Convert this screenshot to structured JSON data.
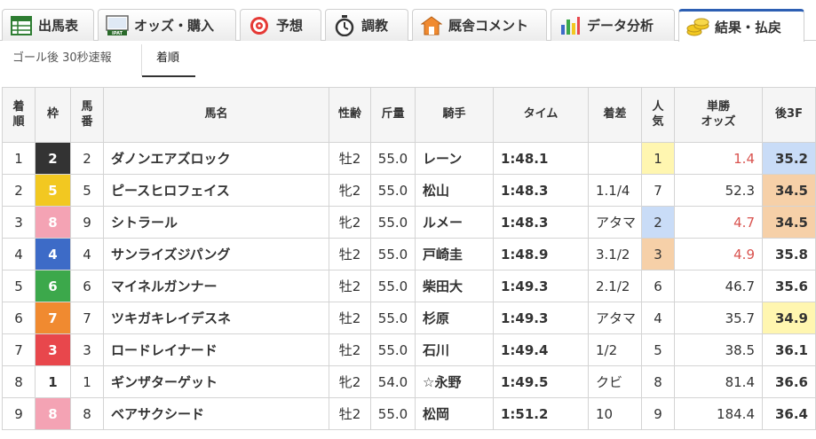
{
  "tabs": [
    {
      "label": "出馬表",
      "icon": "table-icon",
      "active": false
    },
    {
      "label": "オッズ・購入",
      "icon": "ipat-icon",
      "active": false
    },
    {
      "label": "予想",
      "icon": "target-icon",
      "active": false
    },
    {
      "label": "調教",
      "icon": "stopwatch-icon",
      "active": false
    },
    {
      "label": "厩舎コメント",
      "icon": "stable-icon",
      "active": false
    },
    {
      "label": "データ分析",
      "icon": "bar-chart-icon",
      "active": false
    },
    {
      "label": "結果・払戻",
      "icon": "coins-icon",
      "active": true
    }
  ],
  "ipat_badge": "IPAT",
  "subtabs": [
    {
      "label": "ゴール後 30秒速報",
      "active": false
    },
    {
      "label": "着順",
      "active": true
    }
  ],
  "table": {
    "headers": {
      "rank": "着\n順",
      "waku": "枠",
      "umaban": "馬\n番",
      "name": "馬名",
      "sexage": "性齢",
      "weight": "斤量",
      "jockey": "騎手",
      "time": "タイム",
      "margin": "着差",
      "pop": "人\n気",
      "odds": "単勝\nオッズ",
      "last3f": "後3F"
    },
    "rows": [
      {
        "rank": "1",
        "waku": "2",
        "umaban": "2",
        "name": "ダノンエアズロック",
        "sexage": "牡2",
        "weight": "55.0",
        "jockey": "レーン",
        "time": "1:48.1",
        "margin": "",
        "pop": "1",
        "odds": "1.4",
        "last3f": "35.2"
      },
      {
        "rank": "2",
        "waku": "5",
        "umaban": "5",
        "name": "ピースヒロフェイス",
        "sexage": "牝2",
        "weight": "55.0",
        "jockey": "松山",
        "time": "1:48.3",
        "margin": "1.1/4",
        "pop": "7",
        "odds": "52.3",
        "last3f": "34.5"
      },
      {
        "rank": "3",
        "waku": "8",
        "umaban": "9",
        "name": "シトラール",
        "sexage": "牝2",
        "weight": "55.0",
        "jockey": "ルメー",
        "time": "1:48.3",
        "margin": "アタマ",
        "pop": "2",
        "odds": "4.7",
        "last3f": "34.5"
      },
      {
        "rank": "4",
        "waku": "4",
        "umaban": "4",
        "name": "サンライズジパング",
        "sexage": "牡2",
        "weight": "55.0",
        "jockey": "戸崎圭",
        "time": "1:48.9",
        "margin": "3.1/2",
        "pop": "3",
        "odds": "4.9",
        "last3f": "35.8"
      },
      {
        "rank": "5",
        "waku": "6",
        "umaban": "6",
        "name": "マイネルガンナー",
        "sexage": "牡2",
        "weight": "55.0",
        "jockey": "柴田大",
        "time": "1:49.3",
        "margin": "2.1/2",
        "pop": "6",
        "odds": "46.7",
        "last3f": "35.6"
      },
      {
        "rank": "6",
        "waku": "7",
        "umaban": "7",
        "name": "ツキガキレイデスネ",
        "sexage": "牡2",
        "weight": "55.0",
        "jockey": "杉原",
        "time": "1:49.3",
        "margin": "アタマ",
        "pop": "4",
        "odds": "35.7",
        "last3f": "34.9"
      },
      {
        "rank": "7",
        "waku": "3",
        "umaban": "3",
        "name": "ロードレイナード",
        "sexage": "牡2",
        "weight": "55.0",
        "jockey": "石川",
        "time": "1:49.4",
        "margin": "1/2",
        "pop": "5",
        "odds": "38.5",
        "last3f": "36.1"
      },
      {
        "rank": "8",
        "waku": "1",
        "umaban": "1",
        "name": "ギンザターゲット",
        "sexage": "牝2",
        "weight": "54.0",
        "jockey": "☆永野",
        "time": "1:49.5",
        "margin": "クビ",
        "pop": "8",
        "odds": "81.4",
        "last3f": "36.6"
      },
      {
        "rank": "9",
        "waku": "8",
        "umaban": "8",
        "name": "ベアサクシード",
        "sexage": "牡2",
        "weight": "55.0",
        "jockey": "松岡",
        "time": "1:51.2",
        "margin": "10",
        "pop": "9",
        "odds": "184.4",
        "last3f": "36.4"
      }
    ]
  },
  "colors": {
    "waku": {
      "1": {
        "bg": "#ffffff",
        "fg": "#333333"
      },
      "2": {
        "bg": "#333333",
        "fg": "#ffffff"
      },
      "3": {
        "bg": "#e8474c",
        "fg": "#ffffff"
      },
      "4": {
        "bg": "#3d6bc7",
        "fg": "#ffffff"
      },
      "5": {
        "bg": "#f2c821",
        "fg": "#ffffff"
      },
      "6": {
        "bg": "#3ca84b",
        "fg": "#ffffff"
      },
      "7": {
        "bg": "#f08a30",
        "fg": "#ffffff"
      },
      "8": {
        "bg": "#f4a3b4",
        "fg": "#ffffff"
      }
    },
    "pop_highlight": {
      "1": "#fff6b0",
      "2": "#c9dcf7",
      "3": "#f6d0a8"
    },
    "last3f_highlight": {
      "1": "#f6d0a8",
      "2": "#fff6b0",
      "3": "#c9dcf7"
    },
    "odds_hot": "#d9534f",
    "link": "#1a3f96",
    "active_tab_border": "#2d5fb3"
  }
}
